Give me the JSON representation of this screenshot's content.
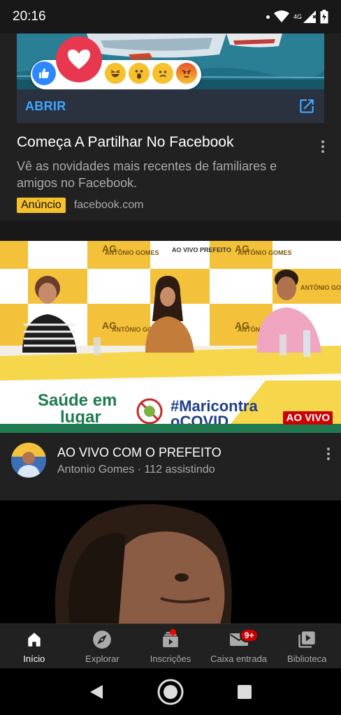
{
  "status_bar": {
    "time": "20:16",
    "network": "4G"
  },
  "ad": {
    "cta_label": "ABRIR",
    "title": "Começa A Partilhar No Facebook",
    "description": "Vê as novidades mais recentes de familiares e amigos no Facebook.",
    "badge": "Anúncio",
    "domain": "facebook.com"
  },
  "live_video": {
    "live_badge": "AO VIVO",
    "title": "AO VIVO COM O PREFEITO",
    "subtitle": "Antonio Gomes · 112 assistindo",
    "banner_text_1": "Saúde em",
    "banner_text_2": "lugar",
    "banner_text_3": "#Maricontra",
    "banner_text_4": "oCOVID",
    "backdrop_text": "ANTÔNIO GOMES",
    "backdrop_prefix": "AG",
    "backdrop_text_2": "AO VIVO PREFEITO"
  },
  "bottom_nav": {
    "items": [
      {
        "label": "Início",
        "icon": "home-icon"
      },
      {
        "label": "Explorar",
        "icon": "explore-icon"
      },
      {
        "label": "Inscrições",
        "icon": "subscriptions-icon"
      },
      {
        "label": "Caixa entrada",
        "icon": "inbox-icon",
        "badge": "9+"
      },
      {
        "label": "Biblioteca",
        "icon": "library-icon"
      }
    ]
  },
  "colors": {
    "accent": "#3ea6ff",
    "live": "#cc0000",
    "ad_badge": "#f7c12e",
    "background": "#181818"
  }
}
